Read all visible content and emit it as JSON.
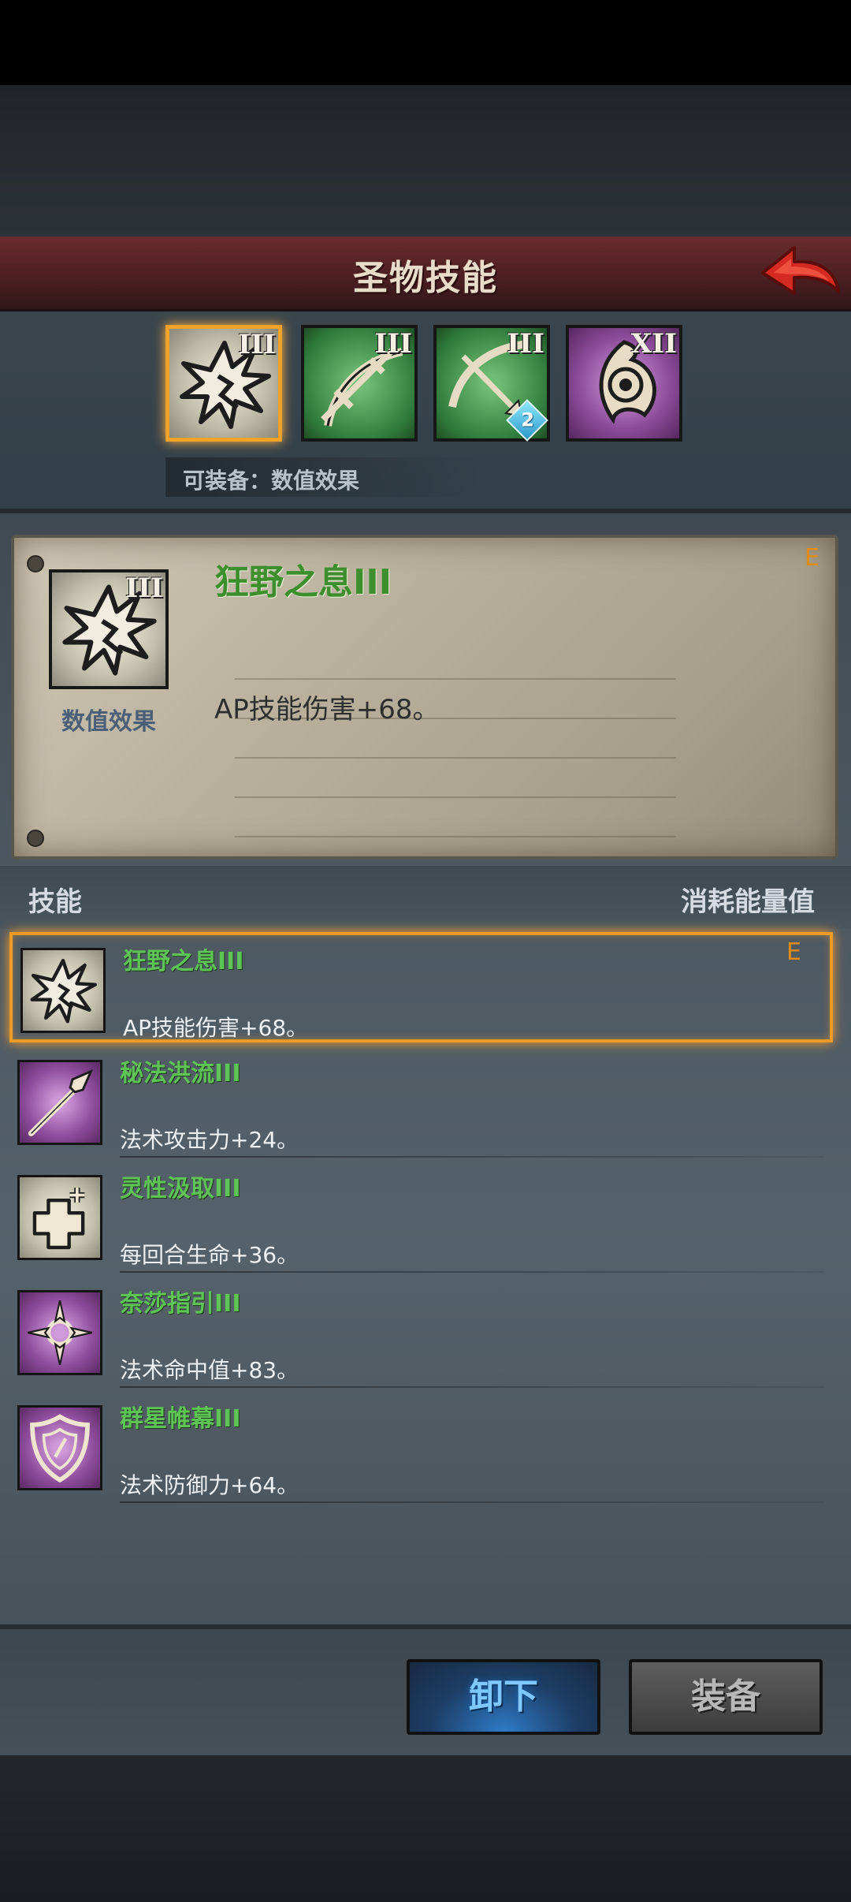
{
  "header": {
    "title": "圣物技能"
  },
  "tabs": [
    {
      "rank": "III",
      "style": "stone",
      "icon": "burst-icon",
      "selected": true
    },
    {
      "rank": "III",
      "style": "green",
      "icon": "sword-bow-icon",
      "selected": false
    },
    {
      "rank": "III",
      "style": "green",
      "icon": "bow-arrow-icon",
      "selected": false,
      "badge": "2"
    },
    {
      "rank": "XII",
      "style": "purple",
      "icon": "eye-orb-icon",
      "selected": false
    }
  ],
  "equip_hint": "可装备：数值效果",
  "detail": {
    "name": "狂野之息III",
    "rank": "III",
    "icon_label": "数值效果",
    "description": "AP技能伤害+68。",
    "equipped_mark": "E"
  },
  "list_header": {
    "left": "技能",
    "right": "消耗能量值"
  },
  "skills": [
    {
      "name": "狂野之息III",
      "description": "AP技能伤害+68。",
      "equipped_mark": "E",
      "icon": "burst-icon",
      "style": "stone",
      "selected": true
    },
    {
      "name": "秘法洪流III",
      "description": "法术攻击力+24。",
      "icon": "spear-icon",
      "style": "purple",
      "selected": false
    },
    {
      "name": "灵性汲取III",
      "description": "每回合生命+36。",
      "icon": "cross-plus-icon",
      "style": "stone",
      "selected": false
    },
    {
      "name": "奈莎指引III",
      "description": "法术命中值+83。",
      "icon": "compass-icon",
      "style": "purple",
      "selected": false
    },
    {
      "name": "群星帷幕III",
      "description": "法术防御力+64。",
      "icon": "shield-icon",
      "style": "purple",
      "selected": false
    }
  ],
  "buttons": {
    "unequip": "卸下",
    "equip": "装备"
  },
  "colors": {
    "selection": "#f29a26",
    "skill_name": "#5fc456",
    "header": "#6b2c2c"
  }
}
